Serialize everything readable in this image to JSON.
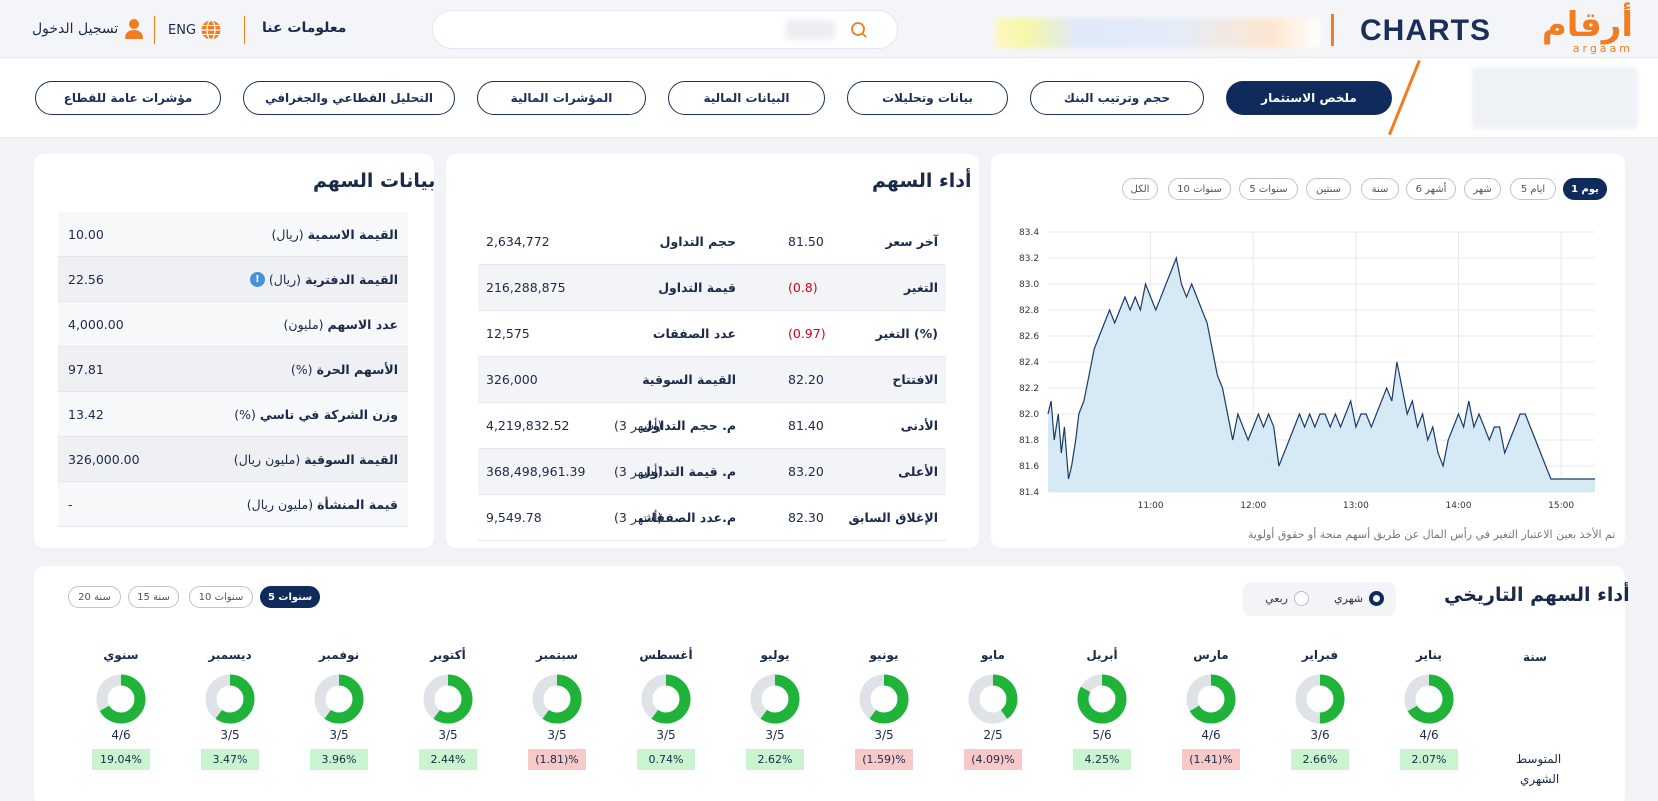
{
  "header": {
    "logo_ar": "أرقام",
    "logo_ar_sub": "argaam",
    "logo_en": "CHARTS",
    "about": "معلومات عنا",
    "lang": "ENG",
    "login": "تسجيل الدخول"
  },
  "nav": {
    "items": [
      {
        "label": "ملخص الاستثمار",
        "active": true
      },
      {
        "label": "حجم وترتيب البنك",
        "active": false
      },
      {
        "label": "بيانات وتحليلات",
        "active": false
      },
      {
        "label": "البيانات المالية",
        "active": false
      },
      {
        "label": "المؤشرات المالية",
        "active": false
      },
      {
        "label": "التحليل القطاعي والجغرافي",
        "active": false
      },
      {
        "label": "مؤشرات عامة للقطاع",
        "active": false
      }
    ]
  },
  "chart_panel": {
    "periods": [
      {
        "label": "1 يوم",
        "active": true
      },
      {
        "label": "5 ايام",
        "active": false
      },
      {
        "label": "شهر",
        "active": false
      },
      {
        "label": "6 أشهر",
        "active": false
      },
      {
        "label": "سنة",
        "active": false
      },
      {
        "label": "سنتين",
        "active": false
      },
      {
        "label": "5 سنوات",
        "active": false
      },
      {
        "label": "10 سنوات",
        "active": false
      },
      {
        "label": "الكل",
        "active": false
      }
    ],
    "note": "تم الأخذ بعين الاعتبار التغير في رأس المال عن طريق أسهم منحة أو حقوق أولوية"
  },
  "chart_data": {
    "type": "area",
    "x_ticks": [
      "11:00",
      "12:00",
      "13:00",
      "14:00",
      "15:00"
    ],
    "y_ticks": [
      "83.4",
      "83.2",
      "83.0",
      "82.8",
      "82.6",
      "82.4",
      "82.2",
      "82.0",
      "81.8",
      "81.6",
      "81.4"
    ],
    "ylim": [
      81.4,
      83.4
    ],
    "xlim": [
      10.0,
      15.33
    ],
    "grid": true,
    "color": "#1b3a6b",
    "fill": "#d6eaf5",
    "series": [
      {
        "x": [
          10.0,
          10.03,
          10.06,
          10.1,
          10.13,
          10.16,
          10.2,
          10.23,
          10.27,
          10.3,
          10.35,
          10.4,
          10.45,
          10.5,
          10.55,
          10.6,
          10.65,
          10.7,
          10.75,
          10.8,
          10.85,
          10.9,
          10.95,
          11.0,
          11.05,
          11.1,
          11.15,
          11.2,
          11.25,
          11.3,
          11.35,
          11.4,
          11.45,
          11.5,
          11.55,
          11.6,
          11.65,
          11.7,
          11.75,
          11.8,
          11.85,
          11.9,
          11.95,
          12.0,
          12.05,
          12.1,
          12.15,
          12.2,
          12.25,
          12.3,
          12.35,
          12.4,
          12.45,
          12.5,
          12.55,
          12.6,
          12.65,
          12.7,
          12.75,
          12.8,
          12.85,
          12.9,
          12.95,
          13.0,
          13.05,
          13.1,
          13.15,
          13.2,
          13.25,
          13.3,
          13.35,
          13.4,
          13.45,
          13.5,
          13.55,
          13.6,
          13.65,
          13.7,
          13.75,
          13.8,
          13.85,
          13.9,
          13.95,
          14.0,
          14.05,
          14.1,
          14.15,
          14.2,
          14.25,
          14.3,
          14.35,
          14.4,
          14.45,
          14.5,
          14.55,
          14.6,
          14.65,
          14.7,
          14.75,
          14.8,
          14.85,
          14.9,
          14.95,
          15.0,
          15.05,
          15.1,
          15.15,
          15.2,
          15.25,
          15.3,
          15.33
        ],
        "y": [
          82.0,
          82.1,
          81.8,
          82.0,
          81.7,
          81.9,
          81.5,
          81.6,
          81.8,
          82.0,
          82.1,
          82.3,
          82.5,
          82.6,
          82.7,
          82.8,
          82.7,
          82.8,
          82.9,
          82.8,
          82.9,
          82.8,
          83.0,
          82.9,
          82.8,
          82.9,
          83.0,
          83.1,
          83.2,
          83.0,
          82.9,
          83.0,
          82.9,
          82.8,
          82.7,
          82.5,
          82.3,
          82.2,
          82.0,
          81.8,
          82.0,
          81.9,
          81.8,
          81.9,
          82.0,
          81.9,
          82.0,
          81.9,
          81.6,
          81.7,
          81.8,
          81.9,
          82.0,
          81.9,
          82.0,
          81.9,
          82.0,
          82.0,
          81.9,
          82.0,
          81.9,
          82.0,
          82.1,
          81.9,
          82.0,
          82.0,
          81.9,
          82.0,
          82.1,
          82.2,
          82.1,
          82.4,
          82.2,
          82.0,
          82.1,
          81.9,
          82.0,
          81.8,
          81.9,
          81.7,
          81.6,
          81.8,
          81.9,
          82.0,
          81.9,
          82.1,
          81.9,
          82.0,
          81.9,
          81.8,
          81.9,
          81.9,
          81.7,
          81.8,
          81.9,
          82.0,
          82.0,
          81.9,
          81.8,
          81.7,
          81.6,
          81.5,
          81.5,
          81.5,
          81.5,
          81.5,
          81.5,
          81.5,
          81.5,
          81.5,
          81.5
        ]
      }
    ]
  },
  "performance": {
    "title": "أداء السهم",
    "rows": [
      {
        "l1": "آخر سعر",
        "v1": "81.50",
        "neg1": false,
        "l2": "حجم التداول",
        "s2": "",
        "v2": "2,634,772"
      },
      {
        "l1": "التغير",
        "v1": "(0.8)",
        "neg1": true,
        "l2": "قيمة التداول",
        "s2": "",
        "v2": "216,288,875"
      },
      {
        "l1": "التغير (%)",
        "v1": "(0.97)",
        "neg1": true,
        "l2": "عدد الصفقات",
        "s2": "",
        "v2": "12,575"
      },
      {
        "l1": "الافتتاح",
        "v1": "82.20",
        "neg1": false,
        "l2": "القيمة السوقية",
        "s2": "",
        "v2": "326,000"
      },
      {
        "l1": "الأدنى",
        "v1": "81.40",
        "neg1": false,
        "l2": "م. حجم التداول",
        "s2": "(3 أشهر)",
        "v2": "4,219,832.52"
      },
      {
        "l1": "الأعلى",
        "v1": "83.20",
        "neg1": false,
        "l2": "م. قيمة التداول",
        "s2": "(3 أشهر)",
        "v2": "368,498,961.39"
      },
      {
        "l1": "الإغلاق السابق",
        "v1": "82.30",
        "neg1": false,
        "l2": "م.عدد الصفقات",
        "s2": "(3 أشهر)",
        "v2": "9,549.78"
      }
    ]
  },
  "stock_data": {
    "title": "بيانات السهم",
    "rows": [
      {
        "label": "القيمة الاسمية",
        "unit": "(ريال)",
        "value": "10.00",
        "info": false
      },
      {
        "label": "القيمة الدفترية",
        "unit": "(ريال)",
        "value": "22.56",
        "info": true
      },
      {
        "label": "عدد الاسهم",
        "unit": "(مليون)",
        "value": "4,000.00",
        "info": false
      },
      {
        "label": "الأسهم الحرة",
        "unit": "(%)",
        "value": "97.81",
        "info": false
      },
      {
        "label": "وزن الشركة في تاسي",
        "unit": "(%)",
        "value": "13.42",
        "info": false
      },
      {
        "label": "القيمة السوقية",
        "unit": "(مليون ريال)",
        "value": "326,000.00",
        "info": false
      },
      {
        "label": "قيمة المنشأة",
        "unit": "(مليون ريال)",
        "value": "-",
        "info": false
      }
    ]
  },
  "history": {
    "title": "أداء السهم التاريخي",
    "radio_monthly": "شهري",
    "radio_quarterly": "ربعي",
    "ranges": [
      {
        "label": "5 سنوات",
        "active": true
      },
      {
        "label": "10 سنوات",
        "active": false
      },
      {
        "label": "15 سنة",
        "active": false
      },
      {
        "label": "20 سنة",
        "active": false
      }
    ],
    "year_label": "سنة",
    "avg_label_1": "المتوسط",
    "avg_label_2": "الشهري",
    "green": "#1fb33a",
    "grey": "#dfe3e8",
    "months": [
      {
        "name": "يناير",
        "ratio": "4/6",
        "frac": 0.6667,
        "avg": "2.07%",
        "positive": true
      },
      {
        "name": "فبراير",
        "ratio": "3/6",
        "frac": 0.5,
        "avg": "2.66%",
        "positive": true
      },
      {
        "name": "مارس",
        "ratio": "4/6",
        "frac": 0.6667,
        "avg": "(1.41)%",
        "positive": false
      },
      {
        "name": "أبريل",
        "ratio": "5/6",
        "frac": 0.8333,
        "avg": "4.25%",
        "positive": true
      },
      {
        "name": "مايو",
        "ratio": "2/5",
        "frac": 0.4,
        "avg": "(4.09)%",
        "positive": false
      },
      {
        "name": "يونيو",
        "ratio": "3/5",
        "frac": 0.6,
        "avg": "(1.59)%",
        "positive": false
      },
      {
        "name": "يوليو",
        "ratio": "3/5",
        "frac": 0.6,
        "avg": "2.62%",
        "positive": true
      },
      {
        "name": "أغسطس",
        "ratio": "3/5",
        "frac": 0.6,
        "avg": "0.74%",
        "positive": true
      },
      {
        "name": "سبتمبر",
        "ratio": "3/5",
        "frac": 0.6,
        "avg": "(1.81)%",
        "positive": false
      },
      {
        "name": "أكتوبر",
        "ratio": "3/5",
        "frac": 0.6,
        "avg": "2.44%",
        "positive": true
      },
      {
        "name": "نوفمبر",
        "ratio": "3/5",
        "frac": 0.6,
        "avg": "3.96%",
        "positive": true
      },
      {
        "name": "ديسمبر",
        "ratio": "3/5",
        "frac": 0.6,
        "avg": "3.47%",
        "positive": true
      },
      {
        "name": "سنوي",
        "ratio": "4/6",
        "frac": 0.6667,
        "avg": "19.04%",
        "positive": true
      }
    ]
  }
}
